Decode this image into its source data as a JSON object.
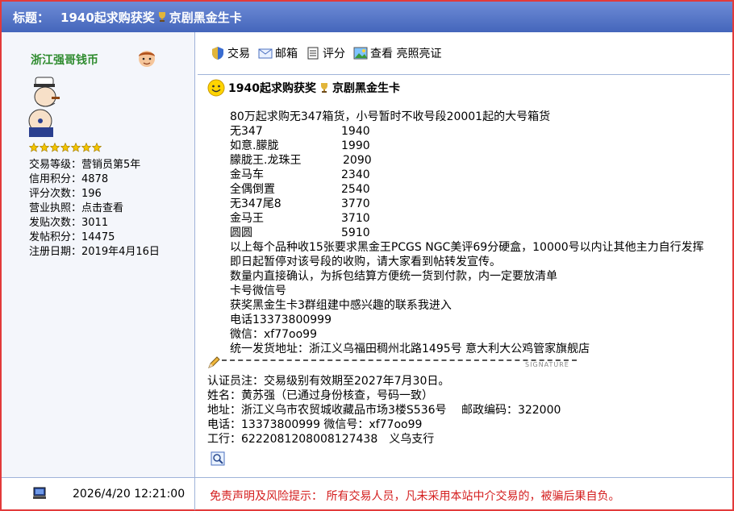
{
  "title_bar": {
    "label": "标题：",
    "title_part1": "1940起求购获奖",
    "title_part2": "京剧黑金生卡"
  },
  "user": {
    "name": "浙江强哥钱币",
    "stats": [
      "交易等级：营销员第5年",
      "信用积分：4878",
      "评分次数：196",
      "营业执照：点击查看",
      "发贴次数：3011",
      "发帖积分：14475",
      "注册日期：2019年4月16日"
    ],
    "star_count": 7
  },
  "toolbar": {
    "trade": "交易",
    "mail": "邮箱",
    "rate": "评分",
    "view_license": "查看 亮照亮证"
  },
  "post": {
    "title_part1": "1940起求购获奖",
    "title_part2": "京剧黑金生卡",
    "intro": "80万起求购无347箱货，小号暂时不收号段20001起的大号箱货",
    "prices": [
      {
        "name": "无347",
        "price": "1940"
      },
      {
        "name": "如意.朦胧",
        "price": "1990"
      },
      {
        "name": "朦胧王.龙珠王",
        "price": "2090"
      },
      {
        "name": "金马车",
        "price": "2340"
      },
      {
        "name": "全偶倒置",
        "price": "2540"
      },
      {
        "name": "无347尾8",
        "price": "3770"
      },
      {
        "name": "金马王",
        "price": "3710"
      },
      {
        "name": "圆圆",
        "price": "5910"
      }
    ],
    "lines": [
      "以上每个品种收15张要求黑金王PCGS NGC美评69分硬盒，10000号以内让其他主力自行发挥",
      "即日起暂停对该号段的收购，请大家看到帖转发宣传。",
      "数量内直接确认，为拆包结算方便统一货到付款，内一定要放清单",
      "卡号微信号",
      "获奖黑金生卡3群组建中感兴趣的联系我进入",
      "电话13373800999",
      "微信：xf77oo99",
      "统一发货地址：浙江义乌福田稠州北路1495号 意大利大公鸡管家旗舰店"
    ]
  },
  "signature": {
    "mark": "SIGNATURE",
    "lines": [
      "认证员注：交易级别有效期至2027年7月30日。",
      "姓名：黄苏强（已通过身份核查，号码一致）",
      "地址：浙江义乌市农贸城收藏品市场3楼S536号　 邮政编码：322000",
      "电话：13373800999  微信号：xf77oo99",
      "工行：6222081208008127438　义乌支行"
    ]
  },
  "footer": {
    "time": "2026/4/20 12:21:00",
    "disclaimer": "免责声明及风险提示： 所有交易人员，凡未采用本站中介交易的，被骗后果自负。"
  },
  "colors": {
    "title_bar": "#4f6fc4",
    "username": "#2e8b2e",
    "disclaimer": "#d41e1e",
    "frame": "#e23a3a"
  }
}
